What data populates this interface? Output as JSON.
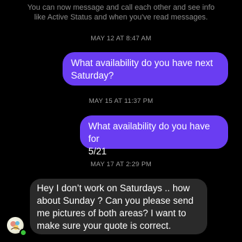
{
  "notice": {
    "line1": "You can now message and call each other and see info",
    "line2": "like Active Status and when you've read messages."
  },
  "messages": [
    {
      "timestamp": "MAY 12 AT 8:47 AM",
      "direction": "outgoing",
      "lines": [
        "What availability do you have next",
        "Saturday?"
      ]
    },
    {
      "timestamp": "MAY 15 AT 11:37 PM",
      "direction": "outgoing",
      "lines": [
        "What availability do you have for",
        "5/21"
      ]
    },
    {
      "timestamp": "MAY 17 AT 2:29 PM",
      "direction": "incoming",
      "lines": [
        "Hey I don’t work on Saturdays .. how",
        "about Sunday ? Can you please send",
        "me pictures of both areas? I want to",
        "make sure your quote is correct."
      ]
    }
  ],
  "contact": {
    "avatar_icon": "contact-avatar-icon",
    "presence": "active"
  },
  "colors": {
    "background": "#000000",
    "outgoing_bubble": "#6a3df2",
    "incoming_bubble": "#2a2a2a",
    "timestamp": "#9a9a9a",
    "presence": "#3ac43a"
  }
}
